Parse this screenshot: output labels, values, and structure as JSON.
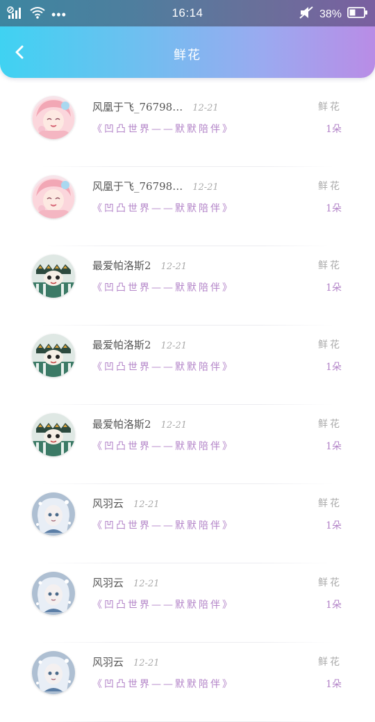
{
  "status_bar": {
    "time": "16:14",
    "battery": "38%",
    "more": "•••"
  },
  "header": {
    "title": "鲜花"
  },
  "list": [
    {
      "name": "风凰于飞_76798…",
      "date": "12-21",
      "album": "《凹凸世界——默默陪伴》",
      "gift": "鲜花",
      "count": "1朵",
      "avatar": "avatar-pink"
    },
    {
      "name": "风凰于飞_76798…",
      "date": "12-21",
      "album": "《凹凸世界——默默陪伴》",
      "gift": "鲜花",
      "count": "1朵",
      "avatar": "avatar-pink"
    },
    {
      "name": "最爱帕洛斯2",
      "date": "12-21",
      "album": "《凹凸世界——默默陪伴》",
      "gift": "鲜花",
      "count": "1朵",
      "avatar": "avatar-green"
    },
    {
      "name": "最爱帕洛斯2",
      "date": "12-21",
      "album": "《凹凸世界——默默陪伴》",
      "gift": "鲜花",
      "count": "1朵",
      "avatar": "avatar-green"
    },
    {
      "name": "最爱帕洛斯2",
      "date": "12-21",
      "album": "《凹凸世界——默默陪伴》",
      "gift": "鲜花",
      "count": "1朵",
      "avatar": "avatar-green"
    },
    {
      "name": "风羽云",
      "date": "12-21",
      "album": "《凹凸世界——默默陪伴》",
      "gift": "鲜花",
      "count": "1朵",
      "avatar": "avatar-blue"
    },
    {
      "name": "风羽云",
      "date": "12-21",
      "album": "《凹凸世界——默默陪伴》",
      "gift": "鲜花",
      "count": "1朵",
      "avatar": "avatar-blue"
    },
    {
      "name": "风羽云",
      "date": "12-21",
      "album": "《凹凸世界——默默陪伴》",
      "gift": "鲜花",
      "count": "1朵",
      "avatar": "avatar-blue"
    }
  ]
}
